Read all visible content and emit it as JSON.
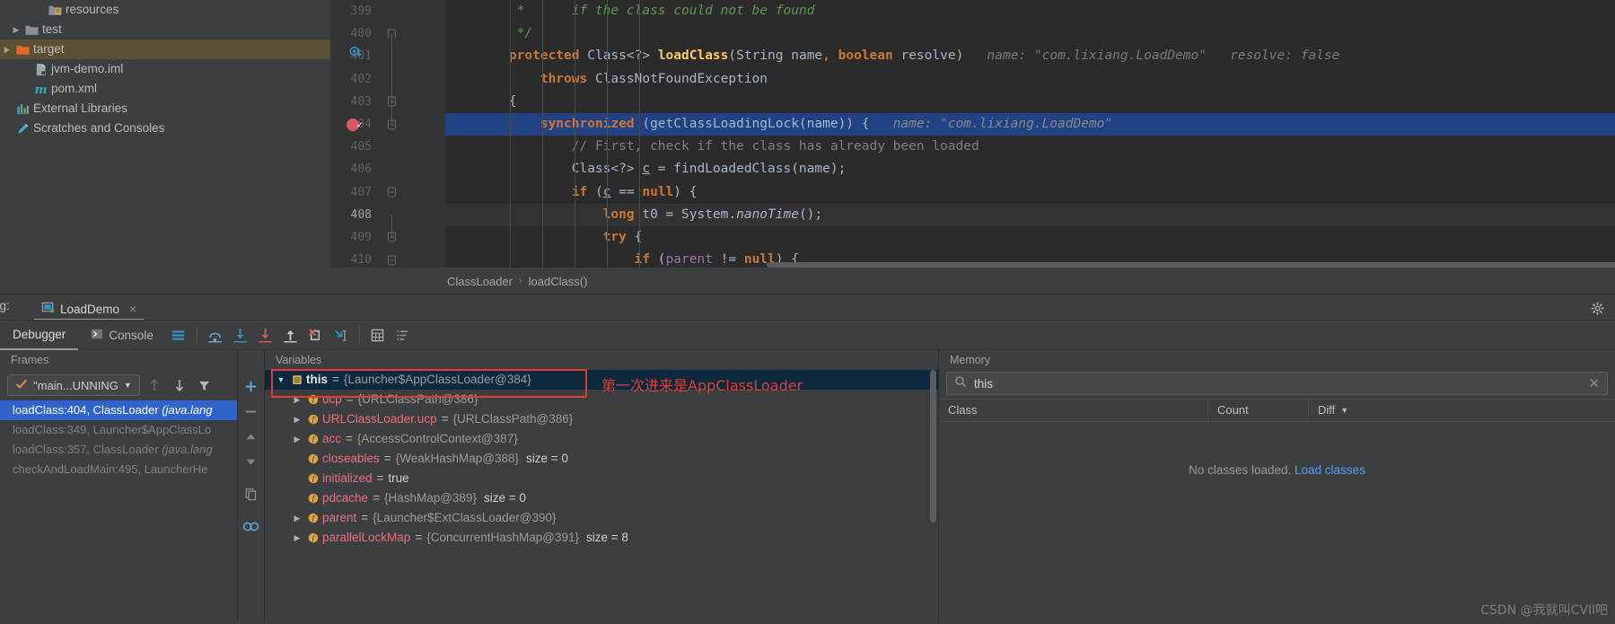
{
  "project_tree": {
    "items": [
      {
        "label": "resources",
        "icon": "resources-folder-icon",
        "arrow": "",
        "indent": 36,
        "selected": false
      },
      {
        "label": "test",
        "icon": "folder-icon",
        "arrow": "▶",
        "indent": 10,
        "selected": false
      },
      {
        "label": "target",
        "icon": "target-folder-icon",
        "arrow": "▶",
        "indent": -6,
        "selected": true
      },
      {
        "label": "jvm-demo.iml",
        "icon": "iml-file-icon",
        "arrow": "",
        "indent": 20,
        "selected": false
      },
      {
        "label": "pom.xml",
        "icon": "maven-icon",
        "arrow": "",
        "indent": 20,
        "selected": false
      },
      {
        "label": "External Libraries",
        "icon": "library-icon",
        "arrow": "",
        "indent": -6,
        "selected": false
      },
      {
        "label": "Scratches and Consoles",
        "icon": "scratches-icon",
        "arrow": "",
        "indent": -6,
        "selected": false
      }
    ]
  },
  "editor": {
    "lines": [
      {
        "num": "399",
        "fold": "",
        "marker": "",
        "state": "",
        "html": "     <span class=\"cm\">*      if the class could not be found</span>"
      },
      {
        "num": "400",
        "fold": "open",
        "marker": "",
        "state": "",
        "html": "     <span class=\"cm\">*/</span>"
      },
      {
        "num": "401",
        "fold": "",
        "marker": "override",
        "state": "",
        "html": "    <span class=\"k\">protected</span> Class&lt;?&gt; <span class=\"fn\">loadClass</span>(String name<span class=\"k\">,</span> <span class=\"k\">boolean</span> resolve)   <span class=\"hint\">name: \"com.lixiang.LoadDemo\"   resolve: false</span>"
      },
      {
        "num": "402",
        "fold": "",
        "marker": "",
        "state": "",
        "html": "        <span class=\"k\">throws</span> ClassNotFoundException"
      },
      {
        "num": "403",
        "fold": "closed",
        "marker": "",
        "state": "",
        "html": "    {"
      },
      {
        "num": "404",
        "fold": "closed",
        "marker": "breakpoint",
        "state": "hl",
        "html": "        <span class=\"k\">synchronized</span> (getClassLoadingLock(name)) {   <span class=\"hint-b\">name: \"com.lixiang.LoadDemo\"</span>"
      },
      {
        "num": "405",
        "fold": "",
        "marker": "",
        "state": "",
        "html": "            <span class=\"c2\">// First, check if the class has already been loaded</span>"
      },
      {
        "num": "406",
        "fold": "",
        "marker": "",
        "state": "",
        "html": "            Class&lt;?&gt; <span class=\"und\">c</span> = findLoadedClass(name);"
      },
      {
        "num": "407",
        "fold": "closed",
        "marker": "",
        "state": "",
        "html": "            <span class=\"k\">if</span> (<span class=\"und\">c</span> == <span class=\"k\">null</span>) {"
      },
      {
        "num": "408",
        "fold": "",
        "marker": "",
        "state": "cur",
        "html": "                <span class=\"k\">long</span> t0 = System.<span class=\"it\">nanoTime</span>();"
      },
      {
        "num": "409",
        "fold": "closed",
        "marker": "",
        "state": "",
        "html": "                <span class=\"k\">try</span> {"
      },
      {
        "num": "410",
        "fold": "closed",
        "marker": "",
        "state": "",
        "html": "                    <span class=\"k\">if</span> (<span class=\"fld\">parent</span> != <span class=\"k\">null</span>) {"
      }
    ]
  },
  "breadcrumb": {
    "class_name": "ClassLoader",
    "separator": "›",
    "method_name": "loadClass()"
  },
  "debug_window": {
    "label": "ug:",
    "run_tab": "LoadDemo",
    "close_icon": "×",
    "settings_icon": "gear-icon"
  },
  "debug_tabs": {
    "debugger": "Debugger",
    "console": "Console",
    "buttons": [
      {
        "name": "layout-settings-icon",
        "glyph": "☰"
      },
      {
        "name": "step-over-icon",
        "glyph": ""
      },
      {
        "name": "step-into-icon",
        "glyph": ""
      },
      {
        "name": "force-step-into-icon",
        "glyph": ""
      },
      {
        "name": "step-out-icon",
        "glyph": ""
      },
      {
        "name": "drop-frame-icon",
        "glyph": ""
      },
      {
        "name": "run-to-cursor-icon",
        "glyph": ""
      },
      {
        "name": "evaluate-expression-icon",
        "glyph": ""
      },
      {
        "name": "sort-variables-icon",
        "glyph": ""
      }
    ]
  },
  "frames": {
    "title": "Frames",
    "thread": "\"main...UNNING",
    "rows": [
      {
        "text": "loadClass:404, ClassLoader ",
        "pkg": "(java.lang",
        "selected": true,
        "dim": false
      },
      {
        "text": "loadClass:349, Launcher$AppClassLo",
        "pkg": "",
        "selected": false,
        "dim": true
      },
      {
        "text": "loadClass:357, ClassLoader ",
        "pkg": "(java.lang",
        "selected": false,
        "dim": true
      },
      {
        "text": "checkAndLoadMain:495, LauncherHe",
        "pkg": "",
        "selected": false,
        "dim": true
      }
    ]
  },
  "variables": {
    "title": "Variables",
    "annotation": "第一次进来是AppClassLoader",
    "rows": [
      {
        "arrow": "▼",
        "icon": "object-icon",
        "name": "this",
        "value": "{Launcher$AppClassLoader@384}",
        "extra": "",
        "selected": true,
        "field": false,
        "indent": 10
      },
      {
        "arrow": "▶",
        "icon": "field-icon",
        "name": "ucp",
        "value": "{URLClassPath@386}",
        "extra": "",
        "selected": false,
        "field": true,
        "indent": 28
      },
      {
        "arrow": "▶",
        "icon": "field-icon",
        "name": "URLClassLoader.ucp",
        "value": "{URLClassPath@386}",
        "extra": "",
        "selected": false,
        "field": true,
        "indent": 28
      },
      {
        "arrow": "▶",
        "icon": "field-icon",
        "name": "acc",
        "value": "{AccessControlContext@387}",
        "extra": "",
        "selected": false,
        "field": true,
        "indent": 28
      },
      {
        "arrow": "",
        "icon": "field-icon",
        "name": "closeables",
        "value": "{WeakHashMap@388}",
        "extra": "size = 0",
        "selected": false,
        "field": true,
        "indent": 28
      },
      {
        "arrow": "",
        "icon": "field-icon",
        "name": "initialized",
        "value": "true",
        "extra": "",
        "selected": false,
        "field": true,
        "indent": 28,
        "primitive": true
      },
      {
        "arrow": "",
        "icon": "field-icon",
        "name": "pdcache",
        "value": "{HashMap@389}",
        "extra": "size = 0",
        "selected": false,
        "field": true,
        "indent": 28
      },
      {
        "arrow": "▶",
        "icon": "field-icon",
        "name": "parent",
        "value": "{Launcher$ExtClassLoader@390}",
        "extra": "",
        "selected": false,
        "field": true,
        "indent": 28
      },
      {
        "arrow": "▶",
        "icon": "field-icon",
        "name": "parallelLockMap",
        "value": "{ConcurrentHashMap@391}",
        "extra": "size = 8",
        "selected": false,
        "field": true,
        "indent": 28
      }
    ]
  },
  "memory": {
    "title": "Memory",
    "search_value": "this",
    "search_placeholder": "",
    "columns": {
      "class": "Class",
      "count": "Count",
      "diff": "Diff"
    },
    "empty_text": "No classes loaded.",
    "load_link": "Load classes"
  },
  "watermark": "CSDN @我就叫CVIl吧",
  "colors": {
    "accent_blue": "#2f65ca",
    "selection_blue": "#214283",
    "annotation_red": "#e83b2e",
    "link_blue": "#589df6",
    "breakpoint_red": "#db5860"
  }
}
